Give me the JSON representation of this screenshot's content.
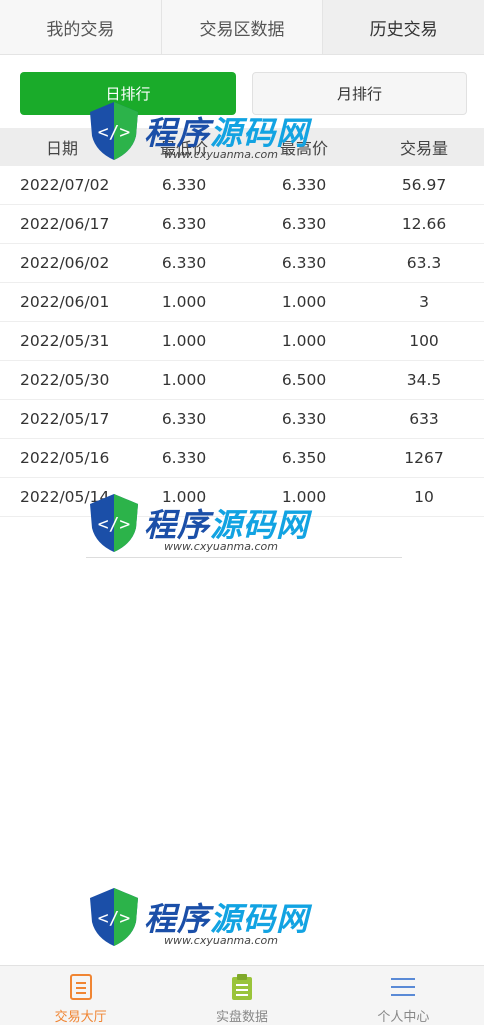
{
  "tabs": [
    "我的交易",
    "交易区数据",
    "历史交易"
  ],
  "rank": {
    "day_label": "日排行",
    "month_label": "月排行"
  },
  "table": {
    "headers": [
      "日期",
      "最低价",
      "最高价",
      "交易量"
    ],
    "rows": [
      [
        "2022/07/02",
        "6.330",
        "6.330",
        "56.97"
      ],
      [
        "2022/06/17",
        "6.330",
        "6.330",
        "12.66"
      ],
      [
        "2022/06/02",
        "6.330",
        "6.330",
        "63.3"
      ],
      [
        "2022/06/01",
        "1.000",
        "1.000",
        "3"
      ],
      [
        "2022/05/31",
        "1.000",
        "1.000",
        "100"
      ],
      [
        "2022/05/30",
        "1.000",
        "6.500",
        "34.5"
      ],
      [
        "2022/05/17",
        "6.330",
        "6.330",
        "633"
      ],
      [
        "2022/05/16",
        "6.330",
        "6.350",
        "1267"
      ],
      [
        "2022/05/14",
        "1.000",
        "1.000",
        "10"
      ]
    ]
  },
  "watermark": {
    "brand1": "程序",
    "brand2": "源码网",
    "url": "www.cxyuanma.com"
  },
  "bottom_nav": [
    {
      "label": "交易大厅",
      "icon": "document-icon",
      "color": "#f08533"
    },
    {
      "label": "实盘数据",
      "icon": "clipboard-icon",
      "color": "#9ac43a"
    },
    {
      "label": "个人中心",
      "icon": "menu-icon",
      "color": "#5a8ad6"
    }
  ],
  "colors": {
    "accent_green": "#1aab2a"
  }
}
